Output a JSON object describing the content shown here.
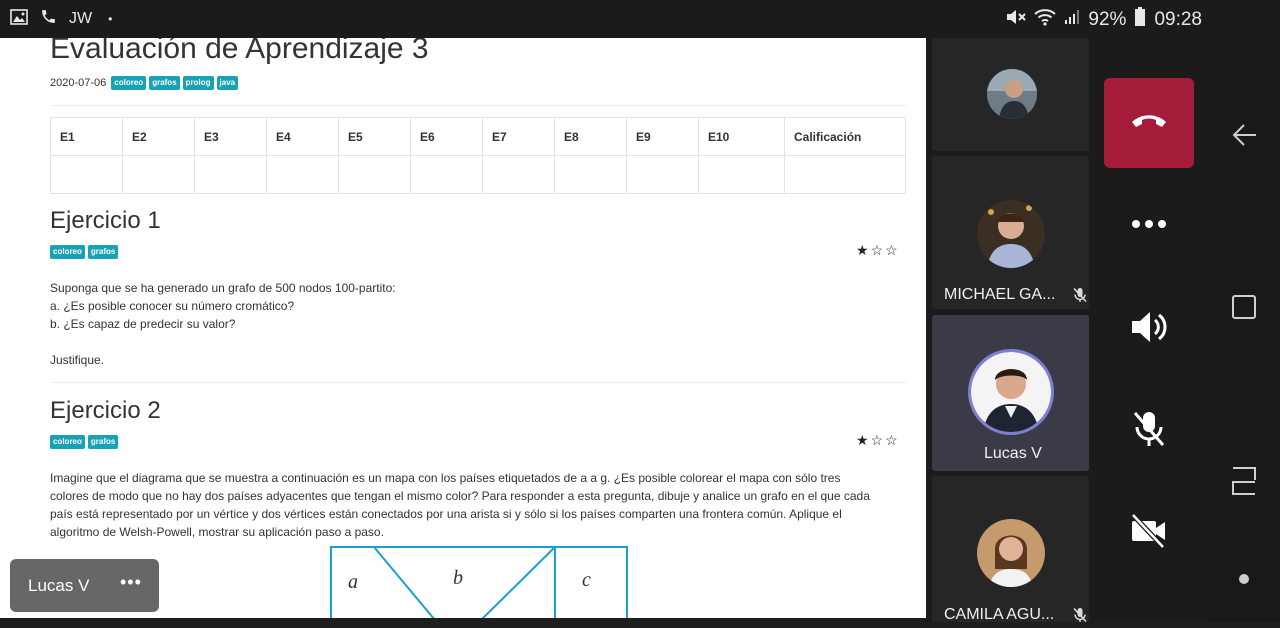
{
  "status_bar": {
    "carrier_initials": "JW",
    "dot": "•",
    "battery": "92%",
    "time": "09:28"
  },
  "document": {
    "title": "Evaluación de Aprendizaje 3",
    "date": "2020-07-06",
    "tags": [
      "coloreo",
      "grafos",
      "prolog",
      "java"
    ],
    "grade_table": {
      "headers": [
        "E1",
        "E2",
        "E3",
        "E4",
        "E5",
        "E6",
        "E7",
        "E8",
        "E9",
        "E10",
        "Calificación"
      ],
      "rows": [
        [
          "",
          "",
          "",
          "",
          "",
          "",
          "",
          "",
          "",
          "",
          ""
        ]
      ]
    },
    "exercises": [
      {
        "title": "Ejercicio 1",
        "tags": [
          "coloreo",
          "grafos"
        ],
        "difficulty_stars": 1,
        "difficulty_max": 3,
        "lines": [
          "Suponga que se ha generado un grafo de 500 nodos 100-partito:",
          "a. ¿Es posible conocer su número cromático?",
          "b. ¿Es capaz de predecir su valor?",
          "",
          "Justifique."
        ]
      },
      {
        "title": "Ejercicio 2",
        "tags": [
          "coloreo",
          "grafos"
        ],
        "difficulty_stars": 1,
        "difficulty_max": 3,
        "lines": [
          "Imagine que el diagrama que se muestra a continuación es un mapa con los países etiquetados de a a g. ¿Es posible colorear el mapa con sólo tres",
          "colores de modo que no hay dos países adyacentes que tengan el mismo color? Para responder a esta pregunta, dibuje y analice un grafo en el que cada",
          "país está representado por un vértice y dos vértices están conectados por una arista si y sólo si los países comparten una frontera común. Aplique el",
          "algoritmo de Welsh-Powell, mostrar su aplicación paso a paso."
        ],
        "diagram_labels": [
          "a",
          "b",
          "c"
        ]
      }
    ]
  },
  "participants": [
    {
      "name": "",
      "muted": false,
      "active": false
    },
    {
      "name": "MICHAEL GA...",
      "muted": true,
      "active": false
    },
    {
      "name": "Lucas V",
      "muted": false,
      "active": true
    },
    {
      "name": "CAMILA AGU...",
      "muted": true,
      "active": false
    }
  ],
  "self_chip": {
    "name": "Lucas V",
    "more": "•••"
  },
  "controls": [
    "hangup-icon",
    "more-options-icon",
    "speaker-icon",
    "mic-off-icon",
    "video-off-icon"
  ],
  "colors": {
    "tag": "#17a2b8",
    "hangup": "#a51c3a",
    "active_tile": "#3b3b48",
    "diagram_stroke": "#1ba1c9"
  }
}
